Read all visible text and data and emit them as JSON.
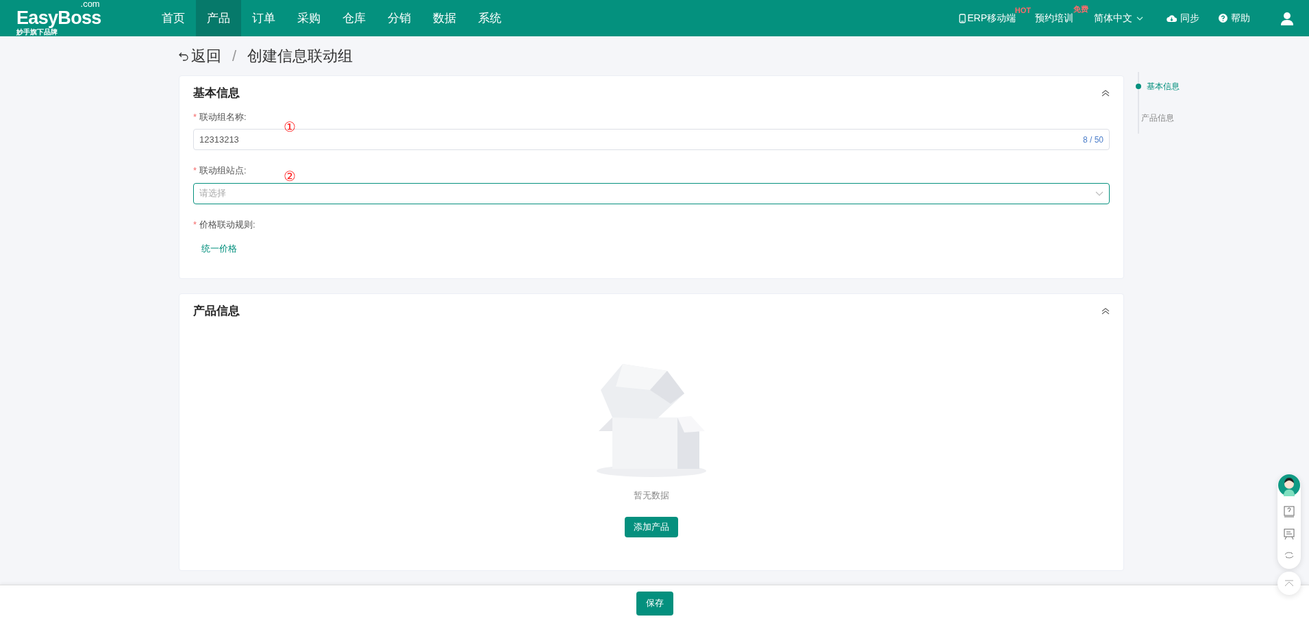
{
  "header": {
    "logo": {
      "text": "EasyBoss",
      "suffix": ".com",
      "tagline": "妙手旗下品牌"
    },
    "nav": [
      {
        "label": "首页",
        "selected": false
      },
      {
        "label": "产品",
        "selected": true
      },
      {
        "label": "订单",
        "selected": false
      },
      {
        "label": "采购",
        "selected": false
      },
      {
        "label": "仓库",
        "selected": false
      },
      {
        "label": "分销",
        "selected": false
      },
      {
        "label": "数据",
        "selected": false
      },
      {
        "label": "系统",
        "selected": false
      }
    ],
    "mobile": {
      "label": "ERP移动端",
      "badge": "HOT"
    },
    "training": {
      "label": "预约培训",
      "badge": "免费"
    },
    "language": "简体中文",
    "sync": "同步",
    "help": "帮助"
  },
  "breadcrumb": {
    "back": "返回",
    "separator": "/",
    "title": "创建信息联动组"
  },
  "basic": {
    "title": "基本信息",
    "fields": [
      {
        "kind": "text",
        "mark": "*",
        "label": "联动组名称:",
        "value": "12313213",
        "counter": "8 / 50",
        "annotation": "①",
        "focused": false
      },
      {
        "kind": "select",
        "mark": "*",
        "label": "联动组站点:",
        "placeholder": "请选择",
        "annotation": "②",
        "focused": true
      },
      {
        "kind": "option",
        "mark": "*",
        "label": "价格联动规则:",
        "value": "统一价格"
      }
    ]
  },
  "products": {
    "title": "产品信息",
    "empty": "暂无数据",
    "add": "添加产品"
  },
  "anchors": [
    {
      "label": "基本信息",
      "selected": true
    },
    {
      "label": "产品信息",
      "selected": false
    }
  ],
  "footer": {
    "save": "保存"
  }
}
